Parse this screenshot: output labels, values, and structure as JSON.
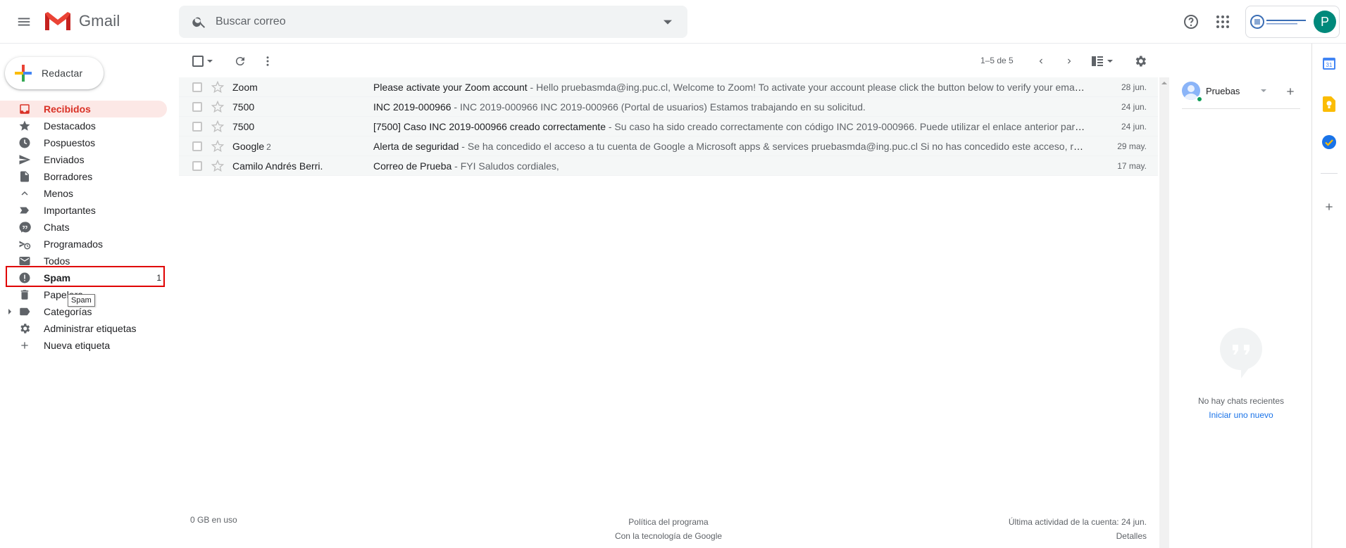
{
  "header": {
    "app_name": "Gmail",
    "search_placeholder": "Buscar correo"
  },
  "sidebar": {
    "compose_label": "Redactar",
    "items": [
      {
        "label": "Recibidos",
        "icon": "inbox-icon",
        "active": true
      },
      {
        "label": "Destacados",
        "icon": "star-icon"
      },
      {
        "label": "Pospuestos",
        "icon": "clock-icon"
      },
      {
        "label": "Enviados",
        "icon": "send-icon"
      },
      {
        "label": "Borradores",
        "icon": "draft-icon"
      },
      {
        "label": "Menos",
        "icon": "chevron-up-icon"
      },
      {
        "label": "Importantes",
        "icon": "important-icon"
      },
      {
        "label": "Chats",
        "icon": "chat-icon"
      },
      {
        "label": "Programados",
        "icon": "scheduled-icon"
      },
      {
        "label": "Todos",
        "icon": "mail-icon"
      },
      {
        "label": "Spam",
        "icon": "spam-icon",
        "count": "1",
        "bold": true
      },
      {
        "label": "Papelera",
        "icon": "trash-icon"
      },
      {
        "label": "Categorías",
        "icon": "label-icon"
      },
      {
        "label": "Administrar etiquetas",
        "icon": "gear-icon"
      },
      {
        "label": "Nueva etiqueta",
        "icon": "plus-icon"
      }
    ],
    "tooltip": "Spam"
  },
  "toolbar": {
    "pager": "1–5 de 5"
  },
  "messages": [
    {
      "sender": "Zoom",
      "count": "",
      "subject": "Please activate your Zoom account",
      "snippet": " - Hello pruebasmda@ing.puc.cl, Welcome to Zoom! To activate your account please click the button below to verify your email address: Activate Account If the button above does not work",
      "date": "28 jun."
    },
    {
      "sender": "7500",
      "count": "",
      "subject": "INC 2019-000966",
      "snippet": " - INC 2019-000966 INC 2019-000966 (Portal de usuarios)  Estamos trabajando en su solicitud.",
      "date": "24 jun."
    },
    {
      "sender": "7500",
      "count": "",
      "subject": "[7500] Caso INC 2019-000966 creado correctamente",
      "snippet": " - Su caso ha sido creado correctamente con código INC 2019-000966. Puede utilizar el enlace anterior para ver el estado de su caso",
      "date": "24 jun."
    },
    {
      "sender": "Google",
      "count": "2",
      "subject": "Alerta de seguridad",
      "snippet": " - Se ha concedido el acceso a tu cuenta de Google a Microsoft apps & services pruebasmda@ing.puc.cl Si no has concedido este acceso, revisa la actividad",
      "date": "29 may."
    },
    {
      "sender": "Camilo Andrés Berri.",
      "count": "",
      "subject": "Correo de Prueba",
      "snippet": " - FYI Saludos cordiales,",
      "date": "17 may."
    }
  ],
  "footer": {
    "storage": "0 GB en uso",
    "policy": "Política del programa",
    "powered": "Con la tecnología de Google",
    "last_activity": "Última actividad de la cuenta: 24 jun.",
    "details": "Detalles"
  },
  "chat": {
    "user": "Pruebas",
    "empty_text": "No hay chats recientes",
    "start_link": "Iniciar uno nuevo"
  },
  "account": {
    "avatar_letter": "P"
  },
  "colors": {
    "accent_red": "#d93025",
    "active_bg": "#fce8e6",
    "highlight": "#e00000",
    "avatar": "#00897b"
  }
}
